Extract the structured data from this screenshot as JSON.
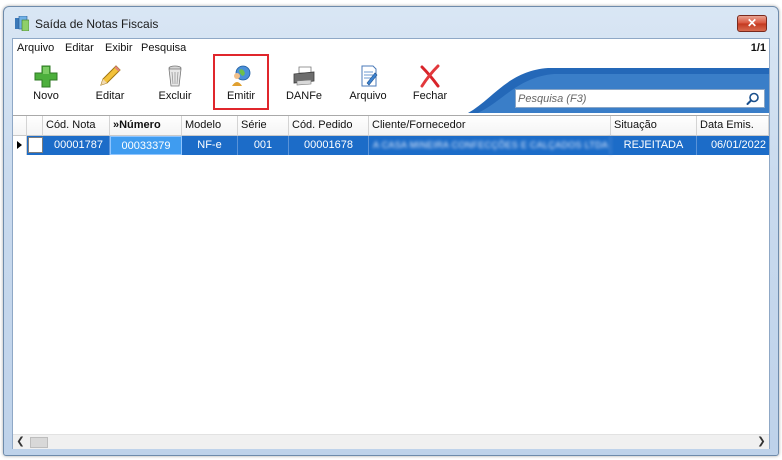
{
  "window": {
    "title": "Saída de Notas Fiscais",
    "close_label": "✕"
  },
  "menu": {
    "items": [
      "Arquivo",
      "Editar",
      "Exibir",
      "Pesquisa"
    ],
    "page_count": "1/1"
  },
  "toolbar": {
    "buttons": [
      {
        "label": "Novo",
        "icon": "plus-icon"
      },
      {
        "label": "Editar",
        "icon": "pencil-icon"
      },
      {
        "label": "Excluir",
        "icon": "trash-icon"
      },
      {
        "label": "Emitir",
        "icon": "globe-person-icon"
      },
      {
        "label": "DANFe",
        "icon": "printer-icon"
      },
      {
        "label": "Arquivo",
        "icon": "document-edit-icon"
      },
      {
        "label": "Fechar",
        "icon": "red-x-icon"
      }
    ],
    "highlighted": "Emitir"
  },
  "search": {
    "placeholder": "Pesquisa (F3)",
    "value": ""
  },
  "grid": {
    "columns": [
      "Cód. Nota",
      "»Número",
      "Modelo",
      "Série",
      "Cód. Pedido",
      "Cliente/Fornecedor",
      "Situação",
      "Data Emis."
    ],
    "sorted_column": "»Número",
    "rows": [
      {
        "cod_nota": "00001787",
        "numero": "00033379",
        "modelo": "NF-e",
        "serie": "001",
        "cod_pedido": "00001678",
        "cliente": "A CASA MINEIRA CONFECÇÕES E CALÇADOS LTDA",
        "situacao": "REJEITADA",
        "data_emis": "06/01/2022"
      }
    ]
  },
  "colors": {
    "selection": "#1c6cc8",
    "focused_cell": "#3f9cf0",
    "highlight_box": "#e0262c",
    "band": "#2468b8"
  }
}
